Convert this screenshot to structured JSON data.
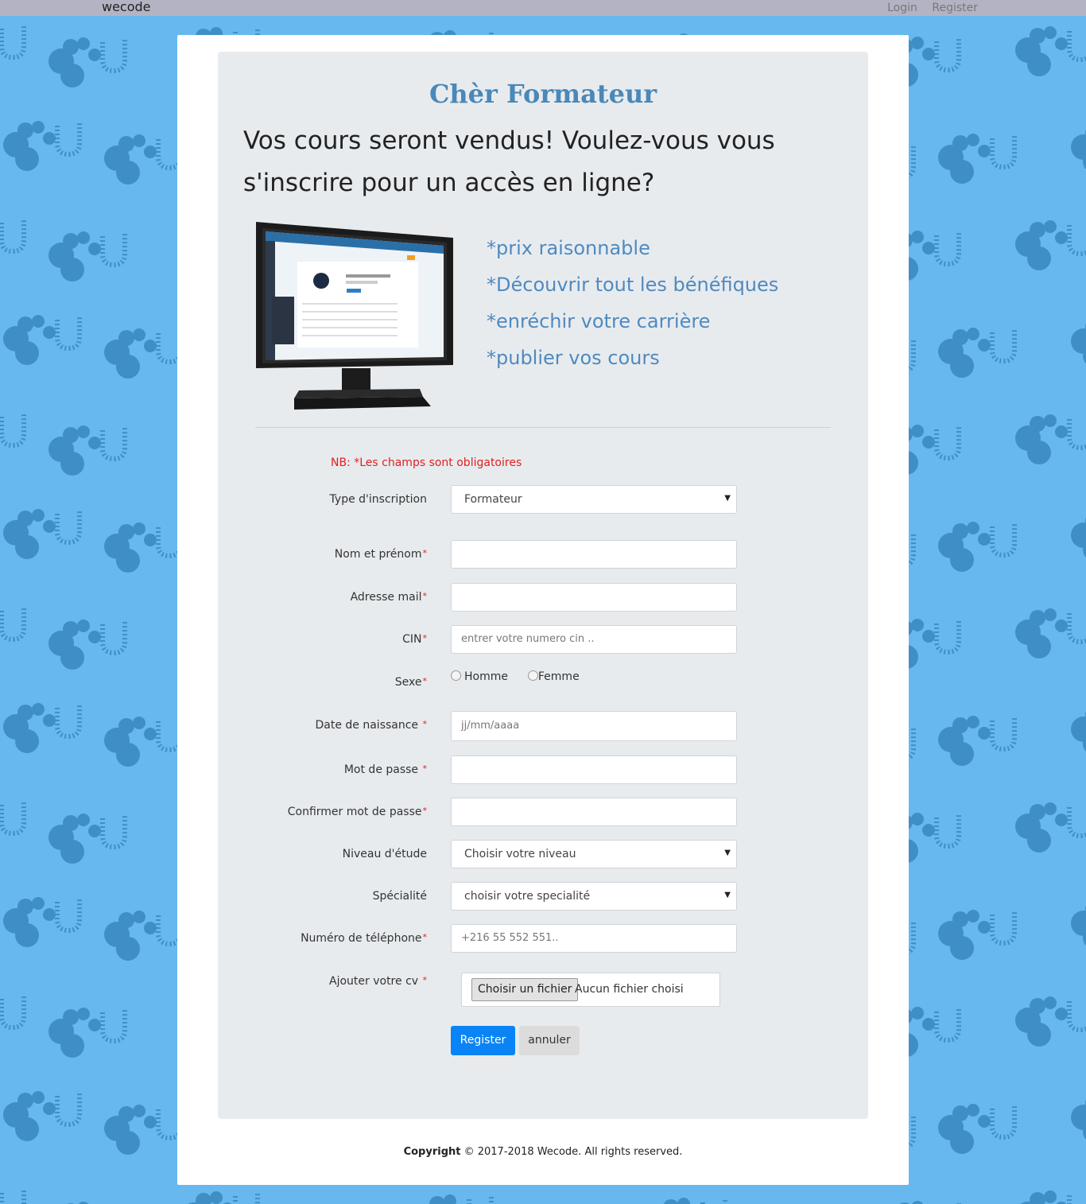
{
  "topbar": {
    "brand": "wecode",
    "login": "Login",
    "register": "Register"
  },
  "header": {
    "title": "Chèr Formateur",
    "headline": "Vos cours seront vendus! Voulez-vous vous s'inscrire pour un accès en ligne?"
  },
  "benefits": [
    "*prix raisonnable",
    "*Découvrir tout les bénéfiques",
    "*enréchir votre carrière",
    "*publier vos cours"
  ],
  "form": {
    "nb_prefix": "NB",
    "nb_text": ": *Les champs sont obligatoires",
    "required_mark": "*",
    "type_label": "Type d'inscription",
    "type_value": "Formateur",
    "name_label": "Nom et prénom",
    "email_label": "Adresse mail",
    "cin_label": "CIN",
    "cin_placeholder": "entrer votre numero cin ..",
    "sexe_label": "Sexe",
    "homme": "Homme",
    "femme": "Femme",
    "birth_label": "Date de naissance ",
    "birth_placeholder": "jj/mm/aaaa",
    "password_label": "Mot de passe ",
    "confirm_label": "Confirmer mot de passe",
    "level_label": "Niveau d'étude",
    "level_value": "Choisir votre niveau",
    "specialty_label": "Spécialité",
    "specialty_value": "choisir votre specialité",
    "phone_label": "Numéro de téléphone",
    "phone_placeholder": "+216 55 552 551..",
    "cv_label": "Ajouter votre cv ",
    "file_button": "Choisir un fichier",
    "file_status": "Aucun fichier choisi",
    "register_button": "Register",
    "cancel_button": "annuler"
  },
  "footer": {
    "copyright_bold": "Copyright",
    "copyright_rest": " © 2017-2018 Wecode. All rights reserved."
  },
  "colors": {
    "background": "#66b8ee",
    "title": "#4a88b8",
    "benefits": "#4f8ac0",
    "primary_button": "#0a84f5",
    "required": "#e02020"
  }
}
